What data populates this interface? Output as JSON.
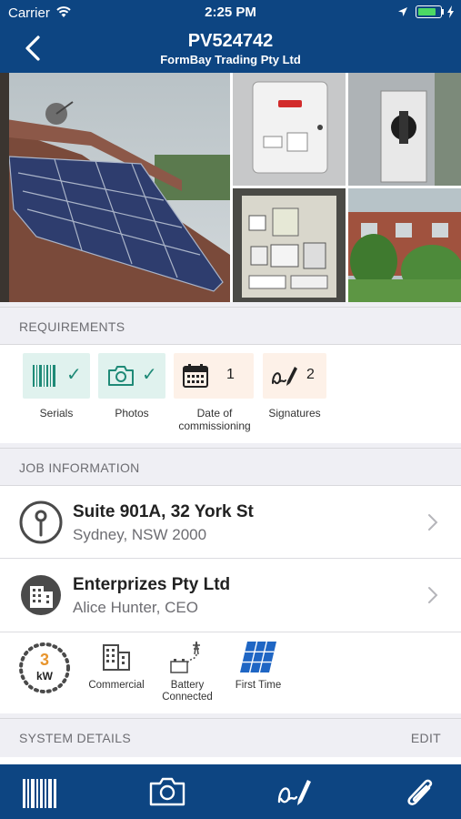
{
  "status_bar": {
    "carrier": "Carrier",
    "time": "2:25 PM"
  },
  "nav": {
    "title": "PV524742",
    "subtitle": "FormBay Trading Pty Ltd"
  },
  "photos": [
    "roof-panels",
    "inverter",
    "isolator-switch",
    "switchboard",
    "house-garden"
  ],
  "requirements": {
    "header": "REQUIREMENTS",
    "items": [
      {
        "label": "Serials",
        "icon": "barcode-icon",
        "state": "done",
        "check": "✓"
      },
      {
        "label": "Photos",
        "icon": "camera-icon",
        "state": "done",
        "check": "✓"
      },
      {
        "label": "Date of commissioning",
        "icon": "calendar-icon",
        "state": "pending",
        "count": "1"
      },
      {
        "label": "Signatures",
        "icon": "signature-icon",
        "state": "pending",
        "count": "2"
      }
    ]
  },
  "job_info": {
    "header": "JOB INFORMATION",
    "address": {
      "line1": "Suite 901A, 32 York St",
      "line2": "Sydney, NSW 2000"
    },
    "company": {
      "name": "Enterprizes Pty Ltd",
      "contact": "Alice Hunter, CEO"
    },
    "properties": {
      "system_size": {
        "value": "3",
        "unit": "kW"
      },
      "commercial": "Commercial",
      "battery_line1": "Battery",
      "battery_line2": "Connected",
      "first_time": "First Time"
    }
  },
  "system_details": {
    "header": "SYSTEM DETAILS",
    "edit": "EDIT"
  },
  "tabbar": [
    "barcode-icon",
    "camera-icon",
    "signature-icon",
    "paperclip-icon"
  ],
  "colors": {
    "brand": "#0d4582",
    "done_bg": "#e0f2ee",
    "pending_bg": "#fdf1e8",
    "done_icon": "#1f8a77",
    "kw_orange": "#e8952d"
  }
}
